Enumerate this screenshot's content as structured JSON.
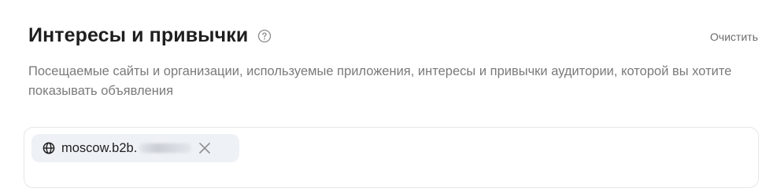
{
  "section": {
    "title": "Интересы и привычки",
    "clear_label": "Очистить",
    "description": "Посещаемые сайты и организации, используемые приложения, интересы и привычки аудитории, которой вы хотите показывать объявления"
  },
  "selected_items": [
    {
      "icon": "globe-icon",
      "label": "moscow.b2b.",
      "remove_icon": "close-icon"
    }
  ],
  "colors": {
    "title": "#1f1f1f",
    "muted_text": "#7a7a7a",
    "chip_background": "#eef1f6",
    "field_border": "#e6e6e6"
  }
}
